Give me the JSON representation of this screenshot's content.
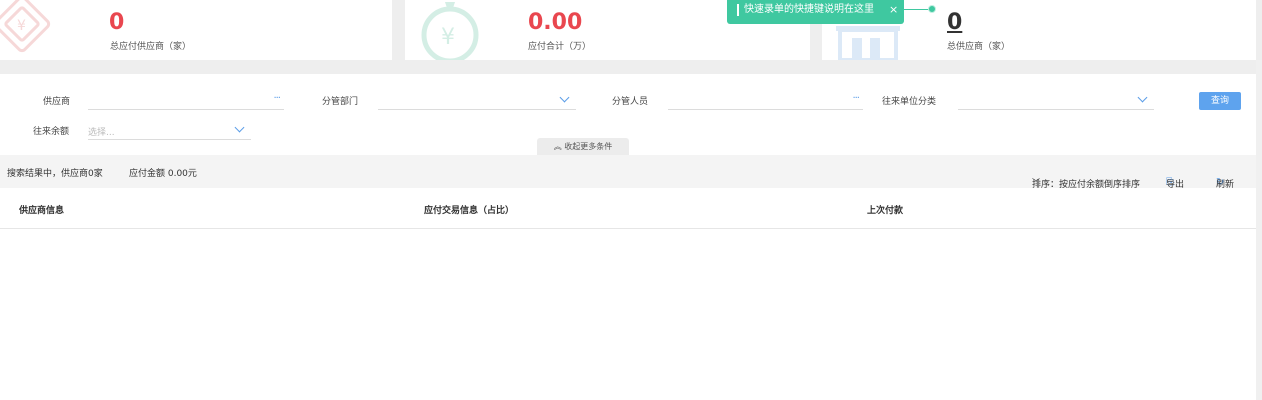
{
  "stats": [
    {
      "value": "0",
      "label": "总应付供应商（家）"
    },
    {
      "value": "0.00",
      "label": "应付合计（万）"
    },
    {
      "value": "0",
      "label": "总供应商（家）"
    }
  ],
  "tooltip": {
    "text": "快速录单的快捷键说明在这里",
    "close": "×"
  },
  "filters": {
    "supplier_label": "供应商",
    "dept_label": "分管部门",
    "person_label": "分管人员",
    "category_label": "往来单位分类",
    "balance_label": "往来余额",
    "balance_placeholder": "选择...",
    "more_icon": "···",
    "query_button": "查询",
    "collapse_label": "收起更多条件",
    "collapse_icon": "︽"
  },
  "summary": {
    "result_text": "搜索结果中，供应商0家",
    "amount_text": "应付金额 0.00元",
    "sort_text": "排序：按应付余额倒序排序",
    "export_label": "导出",
    "refresh_label": "刷新",
    "export_icon": "export-icon",
    "refresh_icon": "refresh-icon"
  },
  "table": {
    "columns": [
      "供应商信息",
      "应付交易信息（占比）",
      "上次付款"
    ],
    "rows": []
  },
  "colors": {
    "accent": "#5ea3ee",
    "danger": "#e9474f",
    "tooltip": "#3fc8a0"
  }
}
